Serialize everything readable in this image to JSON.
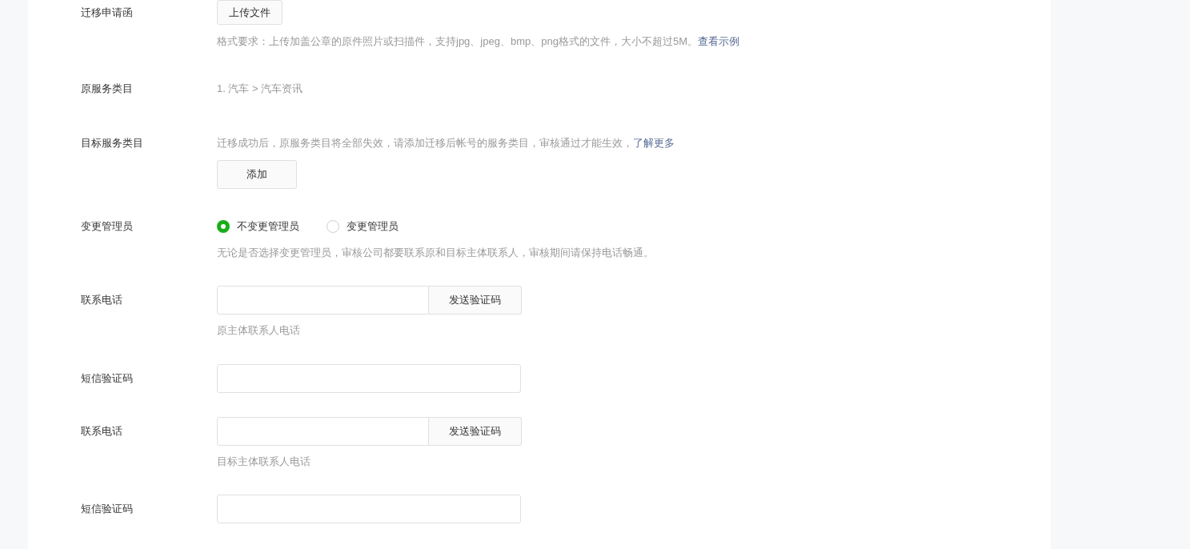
{
  "fields": [
    {
      "kind": "upload",
      "label": "迁移申请函",
      "button": "上传文件",
      "hint": "格式要求：上传加盖公章的原件照片或扫描件，支持jpg、jpeg、bmp、png格式的文件，大小不超过5M。",
      "link": "查看示例"
    },
    {
      "kind": "text",
      "label": "原服务类目",
      "value": "1. 汽车 > 汽车资讯"
    },
    {
      "kind": "category",
      "label": "目标服务类目",
      "hint": "迁移成功后，原服务类目将全部失效，请添加迁移后帐号的服务类目，审核通过才能生效，",
      "link": "了解更多",
      "button": "添加"
    },
    {
      "kind": "radio",
      "label": "变更管理员",
      "options": [
        {
          "label": "不变更管理员",
          "selected": true
        },
        {
          "label": "变更管理员",
          "selected": false
        }
      ],
      "hint": "无论是否选择变更管理员，审核公司都要联系原和目标主体联系人，审核期间请保持电话畅通。"
    },
    {
      "kind": "phone",
      "label": "联系电话",
      "button": "发送验证码",
      "hint": "原主体联系人电话"
    },
    {
      "kind": "code",
      "label": "短信验证码"
    },
    {
      "kind": "phone",
      "label": "联系电话",
      "button": "发送验证码",
      "hint": "目标主体联系人电话"
    },
    {
      "kind": "code",
      "label": "短信验证码"
    }
  ]
}
